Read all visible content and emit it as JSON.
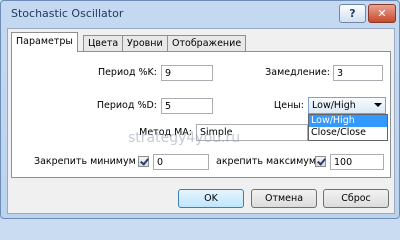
{
  "window": {
    "title": "Stochastic Oscillator"
  },
  "titlebar": {
    "help_label": "?",
    "close_label": "✕"
  },
  "tabs": [
    {
      "label": "Параметры",
      "active": true
    },
    {
      "label": "Цвета",
      "active": false
    },
    {
      "label": "Уровни",
      "active": false
    },
    {
      "label": "Отображение",
      "active": false
    }
  ],
  "params": {
    "period_k": {
      "label": "Период %K:",
      "value": "9"
    },
    "slowing": {
      "label": "Замедление:",
      "value": "3"
    },
    "period_d": {
      "label": "Период %D:",
      "value": "5"
    },
    "prices": {
      "label": "Цены:",
      "selected": "Low/High",
      "options": [
        "Low/High",
        "Close/Close"
      ],
      "highlighted": "Low/High"
    },
    "ma_method": {
      "label": "Метод МА:",
      "selected": "Simple"
    },
    "fix_min": {
      "label": "Закрепить минимум",
      "checked": true,
      "value": "0"
    },
    "fix_max": {
      "label": "акрепить максимум",
      "checked": true,
      "value": "100"
    }
  },
  "watermark": "strategy4you.ru",
  "buttons": {
    "ok": "OK",
    "cancel": "Отмена",
    "reset": "Сброс"
  },
  "colors": {
    "accent": "#3399ff",
    "title_text": "#1e395b",
    "close_button": "#c7492b"
  }
}
